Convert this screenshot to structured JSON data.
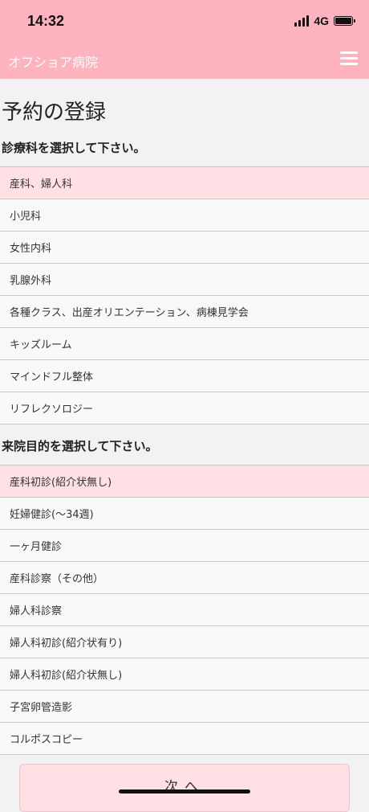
{
  "status": {
    "time": "14:32",
    "network": "4G"
  },
  "header": {
    "title": "オフショア病院",
    "menu_icon": "hamburger-icon"
  },
  "page": {
    "title": "予約の登録"
  },
  "departments": {
    "heading": "診療科を選択して下さい。",
    "items": [
      {
        "label": "産科、婦人科",
        "selected": true
      },
      {
        "label": "小児科",
        "selected": false
      },
      {
        "label": "女性内科",
        "selected": false
      },
      {
        "label": "乳腺外科",
        "selected": false
      },
      {
        "label": "各種クラス、出産オリエンテーション、病棟見学会",
        "selected": false
      },
      {
        "label": "キッズルーム",
        "selected": false
      },
      {
        "label": "マインドフル整体",
        "selected": false
      },
      {
        "label": "リフレクソロジー",
        "selected": false
      }
    ]
  },
  "purposes": {
    "heading": "来院目的を選択して下さい。",
    "items": [
      {
        "label": "産科初診(紹介状無し)",
        "selected": true
      },
      {
        "label": "妊婦健診(〜34週)",
        "selected": false
      },
      {
        "label": "一ヶ月健診",
        "selected": false
      },
      {
        "label": "産科診察（その他）",
        "selected": false
      },
      {
        "label": "婦人科診察",
        "selected": false
      },
      {
        "label": "婦人科初診(紹介状有り)",
        "selected": false
      },
      {
        "label": "婦人科初診(紹介状無し)",
        "selected": false
      },
      {
        "label": "子宮卵管造影",
        "selected": false
      },
      {
        "label": "コルポスコピー",
        "selected": false
      }
    ]
  },
  "actions": {
    "next_label": "次へ"
  },
  "colors": {
    "header": "#ffb3bf",
    "selected_row": "#ffe0e4",
    "background": "#f2f2f2"
  }
}
